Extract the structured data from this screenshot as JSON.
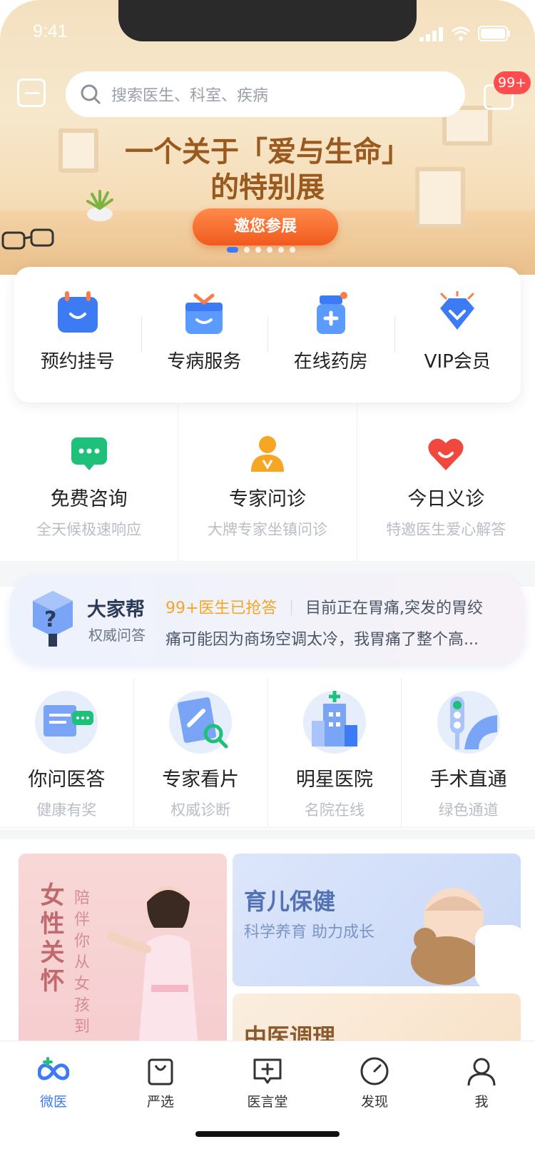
{
  "status_bar": {
    "time": "9:41"
  },
  "search": {
    "placeholder": "搜索医生、科室、疾病"
  },
  "badge": {
    "count": "99+"
  },
  "banner": {
    "line1": "一个关于「爱与生命」",
    "line2": "的特别展",
    "button": "邀您参展",
    "dots_total": 6,
    "dots_active": 1
  },
  "quick_actions": [
    {
      "label": "预约挂号",
      "icon": "calendar-icon"
    },
    {
      "label": "专病服务",
      "icon": "gift-box-icon"
    },
    {
      "label": "在线药房",
      "icon": "medicine-bottle-icon"
    },
    {
      "label": "VIP会员",
      "icon": "diamond-icon"
    }
  ],
  "consult": [
    {
      "label": "免费咨询",
      "sub": "全天候极速响应",
      "icon": "chat-bubble-icon"
    },
    {
      "label": "专家问诊",
      "sub": "大牌专家坐镇问诊",
      "icon": "expert-icon"
    },
    {
      "label": "今日义诊",
      "sub": "特邀医生爱心解答",
      "icon": "heart-icon"
    }
  ],
  "help": {
    "title": "大家帮",
    "sub": "权威问答",
    "count": "99+医生已抢答",
    "question_line1": "目前正在胃痛,突发的胃绞",
    "question_line2": "痛可能因为商场空调太冷，我胃痛了整个高..."
  },
  "features": [
    {
      "label": "你问医答",
      "sub": "健康有奖",
      "icon": "qa-icon"
    },
    {
      "label": "专家看片",
      "sub": "权威诊断",
      "icon": "xray-icon"
    },
    {
      "label": "明星医院",
      "sub": "名院在线",
      "icon": "hospital-icon"
    },
    {
      "label": "手术直通",
      "sub": "绿色通道",
      "icon": "traffic-light-icon"
    }
  ],
  "cards": {
    "women_title": "女性关怀",
    "women_sub": "陪伴你从女孩到",
    "baby_title": "育儿保健",
    "baby_sub": "科学养育 助力成长",
    "tcm_title": "中医调理"
  },
  "tabs": [
    {
      "label": "微医",
      "icon": "weiyi-logo-icon",
      "active": true
    },
    {
      "label": "严选",
      "icon": "shopping-bag-icon",
      "active": false
    },
    {
      "label": "医言堂",
      "icon": "message-plus-icon",
      "active": false
    },
    {
      "label": "发现",
      "icon": "compass-icon",
      "active": false
    },
    {
      "label": "我",
      "icon": "user-icon",
      "active": false
    }
  ],
  "colors": {
    "accent": "#3d7bf5",
    "badge": "#ff4d4f",
    "highlight": "#f5a623"
  }
}
